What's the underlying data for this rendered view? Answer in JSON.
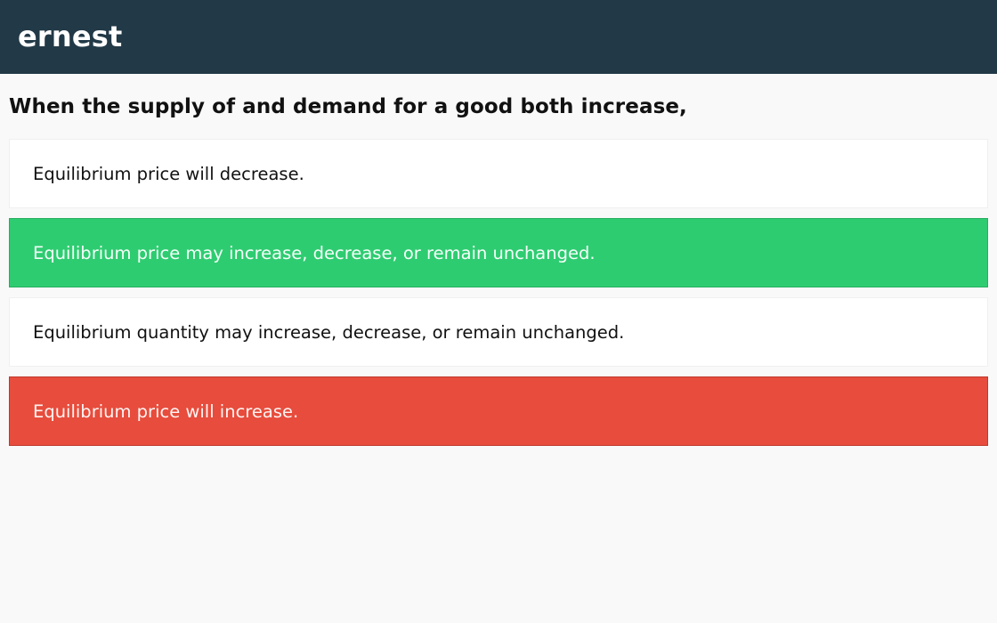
{
  "header": {
    "brand": "ernest"
  },
  "question": {
    "text": "When the supply of and demand for a good both increase,"
  },
  "answers": [
    {
      "text": "Equilibrium price will decrease.",
      "state": "neutral"
    },
    {
      "text": "Equilibrium price may increase, decrease, or remain unchanged.",
      "state": "correct"
    },
    {
      "text": "Equilibrium quantity may increase, decrease, or remain unchanged.",
      "state": "neutral"
    },
    {
      "text": "Equilibrium price will increase.",
      "state": "wrong"
    }
  ],
  "colors": {
    "header_bg": "#223947",
    "page_bg": "#f9f9f9",
    "correct": "#2ecc71",
    "wrong": "#e74c3c"
  }
}
